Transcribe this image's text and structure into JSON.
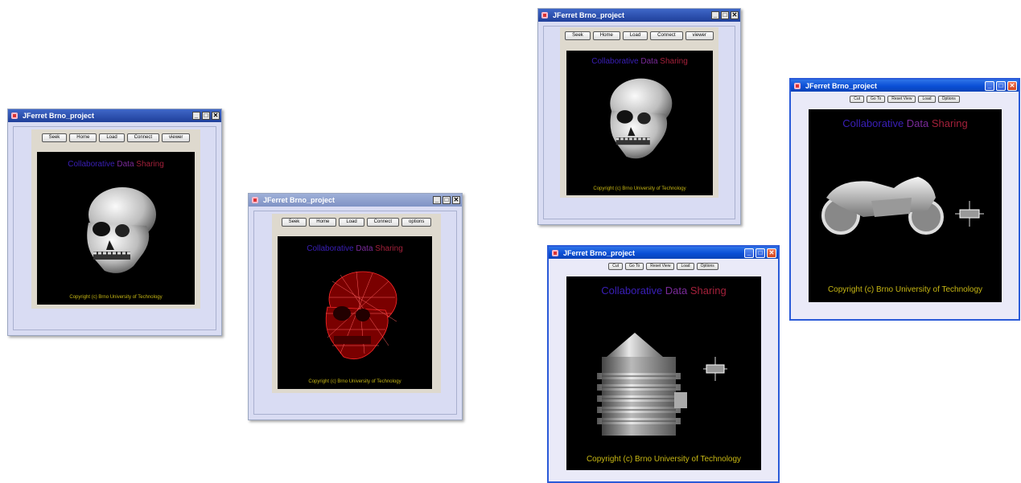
{
  "app_title": "JFerret Brno_project",
  "view_title": {
    "part1": "Collaborative ",
    "part2": "Data ",
    "part3": "Sharing"
  },
  "copyright": "Copyright (c) Brno University of Technology",
  "window_controls": {
    "minimize": "_",
    "maximize": "□",
    "close": "✕"
  },
  "windows": [
    {
      "toolbar": [
        "Seek",
        "Home",
        "Load",
        "Connect",
        "viewer"
      ],
      "model": "skull-solid"
    },
    {
      "toolbar": [
        "Seek",
        "Home",
        "Load",
        "Connect",
        "options"
      ],
      "model": "skull-wireframe"
    },
    {
      "toolbar": [
        "Seek",
        "Home",
        "Load",
        "Connect",
        "viewer"
      ],
      "model": "skull-solid"
    },
    {
      "toolbar": [
        "Cut",
        "Go To",
        "Reset View",
        "Load",
        "Options"
      ],
      "model": "engine-cylinder"
    },
    {
      "toolbar": [
        "Cut",
        "Go To",
        "Reset View",
        "Load",
        "Options"
      ],
      "model": "motorcycle"
    }
  ],
  "colors": {
    "title_active": "#1f3f9a",
    "title_xp": "#0a4fd6",
    "client_bg": "#d9dcf3",
    "view_bg": "#000000",
    "copyright": "#c8b814"
  }
}
